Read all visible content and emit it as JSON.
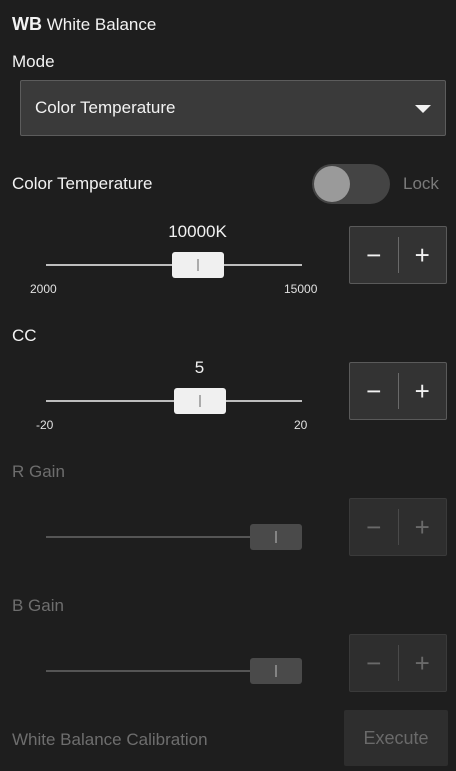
{
  "header": {
    "badge": "WB",
    "title": "White Balance"
  },
  "mode": {
    "label": "Mode",
    "selected": "Color Temperature",
    "caret_icon": "chevron-down-icon"
  },
  "color_temperature": {
    "label": "Color Temperature",
    "lock_label": "Lock",
    "lock_on": false,
    "value_text": "10000K",
    "value": 10000,
    "min": 2000,
    "max": 15000,
    "min_label": "2000",
    "max_label": "15000"
  },
  "cc": {
    "label": "CC",
    "value_text": "5",
    "value": 5,
    "min": -20,
    "max": 20,
    "min_label": "-20",
    "max_label": "20"
  },
  "r_gain": {
    "label": "R Gain",
    "level": 1.0
  },
  "b_gain": {
    "label": "B Gain",
    "level": 1.0
  },
  "stepper": {
    "minus": "−",
    "plus": "+"
  },
  "calibration": {
    "label": "White Balance Calibration",
    "execute": "Execute"
  },
  "colors": {
    "background": "#1e1e1e",
    "text": "#f2f2f2",
    "disabled": "#6e6e6e"
  }
}
